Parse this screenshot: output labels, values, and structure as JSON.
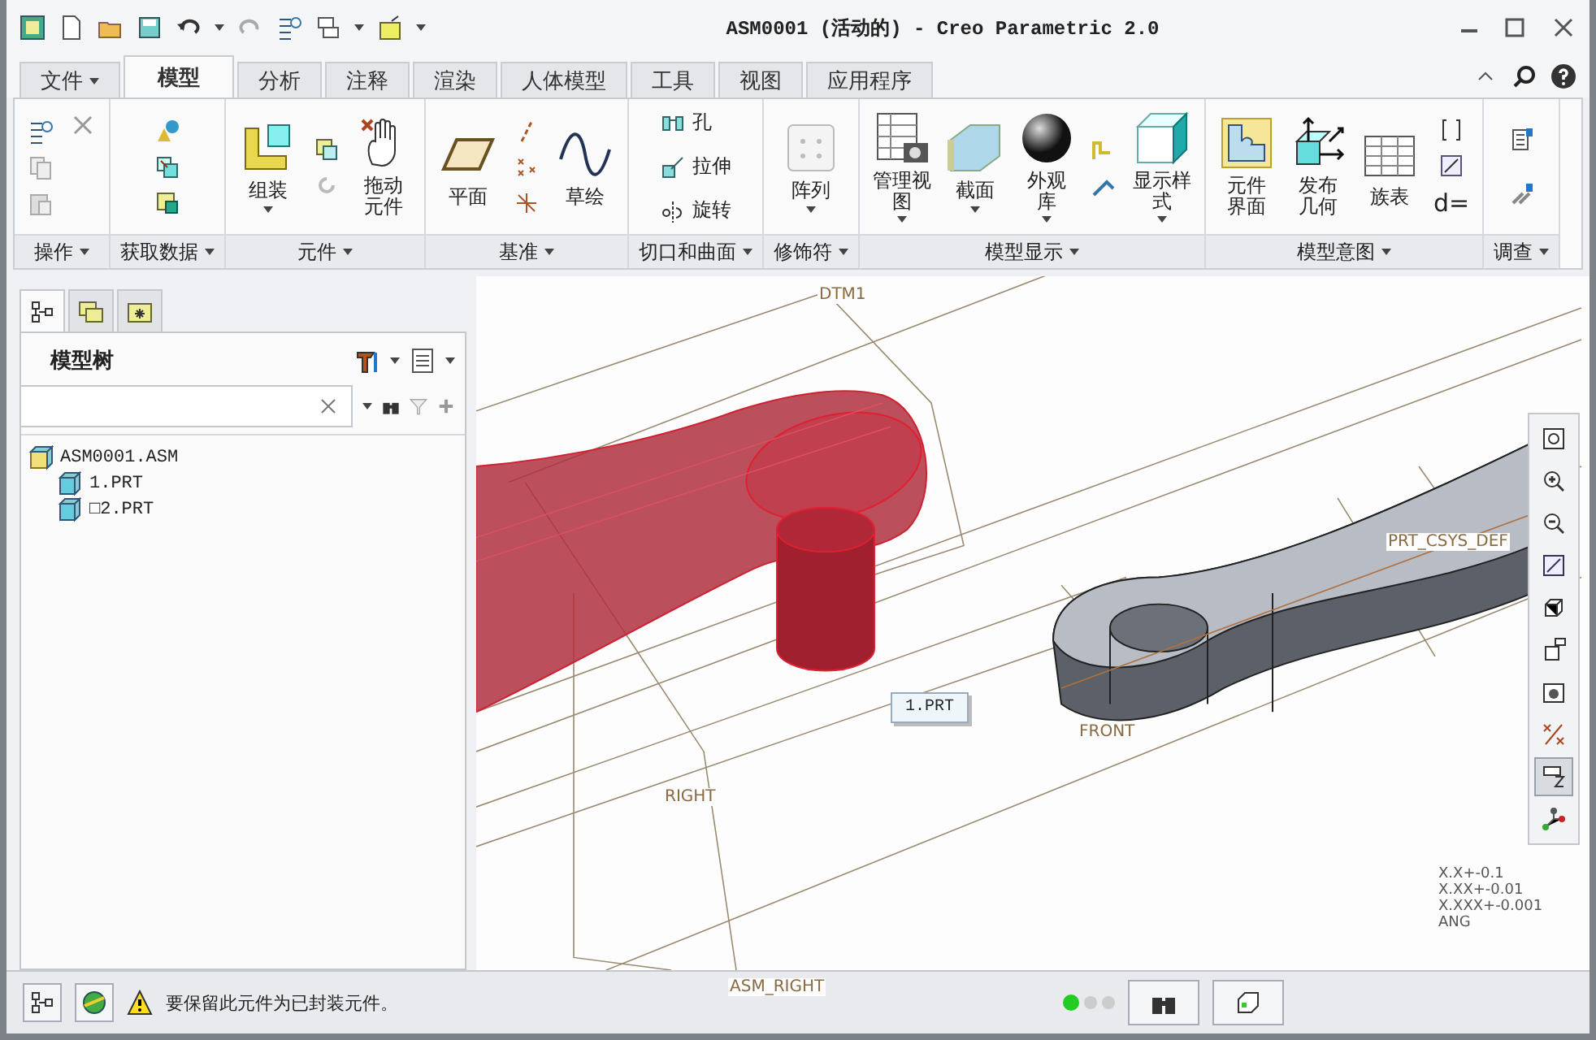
{
  "window": {
    "title": "ASM0001 (活动的) - Creo Parametric 2.0"
  },
  "tabs": [
    {
      "label": "文件",
      "selected": false,
      "dropdown": true
    },
    {
      "label": "模型",
      "selected": true
    },
    {
      "label": "分析",
      "selected": false
    },
    {
      "label": "注释",
      "selected": false
    },
    {
      "label": "渲染",
      "selected": false
    },
    {
      "label": "人体模型",
      "selected": false
    },
    {
      "label": "工具",
      "selected": false
    },
    {
      "label": "视图",
      "selected": false
    },
    {
      "label": "应用程序",
      "selected": false
    }
  ],
  "ribbon_groups": [
    {
      "label": "操作",
      "kind": "operations"
    },
    {
      "label": "获取数据",
      "kind": "getdata"
    },
    {
      "label": "元件",
      "kind": "component",
      "items": [
        {
          "label": "组装",
          "dropdown": true
        },
        {
          "label": "拖动元件"
        }
      ]
    },
    {
      "label": "基准",
      "kind": "datum",
      "items": [
        {
          "label": "平面"
        },
        {
          "label": "草绘"
        }
      ]
    },
    {
      "label": "切口和曲面",
      "kind": "cuts",
      "items": [
        {
          "label": "孔"
        },
        {
          "label": "拉伸"
        },
        {
          "label": "旋转"
        }
      ]
    },
    {
      "label": "修饰符",
      "kind": "modifiers",
      "items": [
        {
          "label": "阵列",
          "dropdown": true
        }
      ]
    },
    {
      "label": "模型显示",
      "kind": "display",
      "items": [
        {
          "label": "管理视图",
          "dropdown": true
        },
        {
          "label": "截面",
          "dropdown": true
        },
        {
          "label": "外观库",
          "dropdown": true
        },
        {
          "label": "显示样式",
          "dropdown": true
        }
      ]
    },
    {
      "label": "模型意图",
      "kind": "intent",
      "items": [
        {
          "label": "元件界面"
        },
        {
          "label": "发布几何"
        },
        {
          "label": "族表"
        },
        {
          "label": "d="
        }
      ]
    },
    {
      "label": "调查",
      "kind": "investigate"
    }
  ],
  "panel": {
    "tabs": [
      {
        "selected": true
      },
      {
        "selected": false
      },
      {
        "selected": false
      }
    ],
    "title": "模型树",
    "tree": [
      {
        "label": "ASM0001.ASM",
        "children": [
          {
            "label": "1.PRT"
          },
          {
            "label": "□2.PRT"
          }
        ]
      }
    ]
  },
  "canvas": {
    "labels": [
      "DTM1",
      "RIGHT",
      "PRT_CSYS_DEF",
      "FRONT",
      "ASM_RIGHT"
    ],
    "tooltip": "1.PRT",
    "tolerances": [
      "X.X+-0.1",
      "X.XX+-0.01",
      "X.XXX+-0.001",
      "ANG"
    ],
    "view_toolbar": [
      {
        "selected": false
      },
      {
        "selected": false
      },
      {
        "selected": false
      },
      {
        "selected": false
      },
      {
        "selected": false
      },
      {
        "selected": false
      },
      {
        "selected": false
      },
      {
        "selected": false
      },
      {
        "selected": true
      },
      {
        "selected": false
      }
    ]
  },
  "status_bar": {
    "message": "要保留此元件为已封装元件。"
  }
}
